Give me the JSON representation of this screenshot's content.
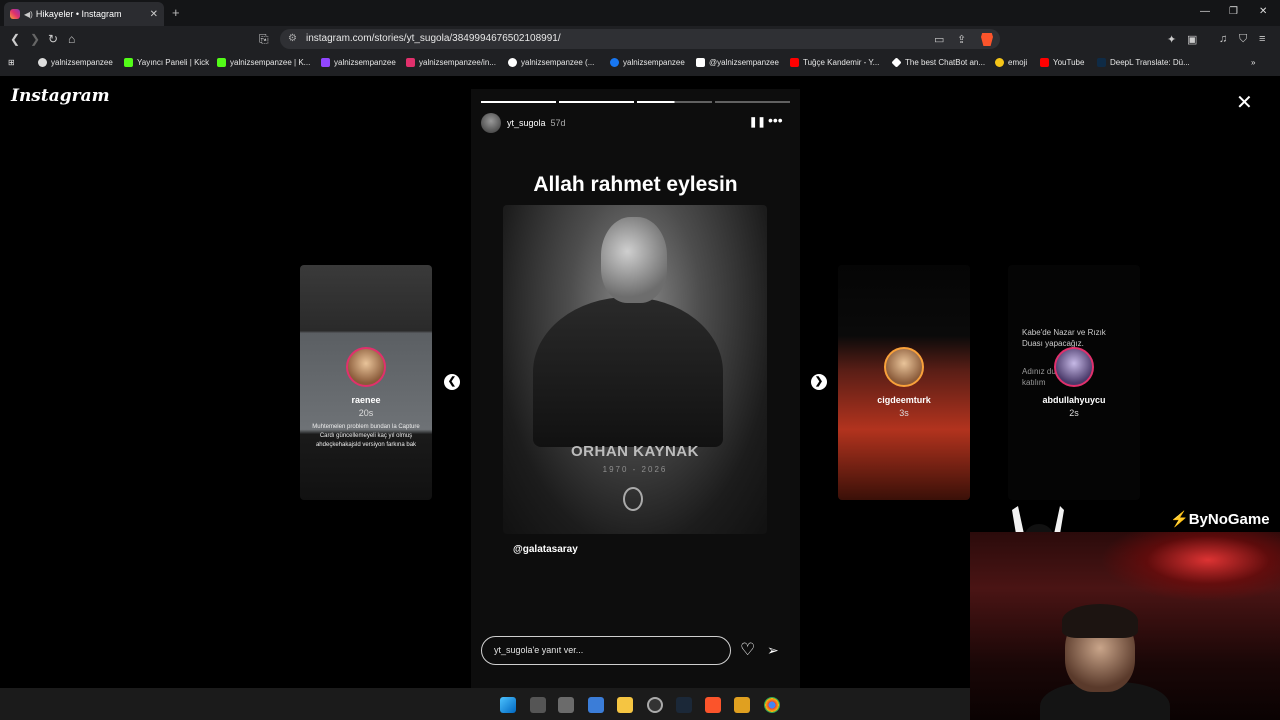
{
  "browser": {
    "tab_title": "Hikayeler • Instagram",
    "url": "instagram.com/stories/yt_sugola/3849994676502108991/",
    "bookmarks": [
      {
        "label": "yalnizsempanzee",
        "color": "#dddddd"
      },
      {
        "label": "Yayıncı Paneli | Kick",
        "color": "#53fc18"
      },
      {
        "label": "yalnizsempanzee | K...",
        "color": "#53fc18"
      },
      {
        "label": "yalnizsempanzee",
        "color": "#9146ff"
      },
      {
        "label": "yalnizsempanzee/in...",
        "color": "#e1306c"
      },
      {
        "label": "yalnizsempanzee (...",
        "color": "#ffffff"
      },
      {
        "label": "yalnizsempanzee",
        "color": "#1877f2"
      },
      {
        "label": "@yalnizsempanzee",
        "color": "#ffffff"
      },
      {
        "label": "Tuğçe Kandemir - Y...",
        "color": "#ff0000"
      },
      {
        "label": "The best ChatBot an...",
        "color": "#ffffff"
      },
      {
        "label": "emoji",
        "color": "#f5c518"
      },
      {
        "label": "YouTube",
        "color": "#ff0000"
      },
      {
        "label": "DeepL Translate: Dü...",
        "color": "#0f2b46"
      }
    ]
  },
  "instagram": {
    "logo": "Instagram"
  },
  "story": {
    "username": "yt_sugola",
    "time": "57d",
    "caption": "Allah rahmet eylesin",
    "photo_name": "ORHAN KAYNAK",
    "photo_years": "1970 - 2026",
    "mention": "@galatasaray",
    "reply_placeholder": "yt_sugola'e yanıt ver..."
  },
  "side_stories": {
    "left": {
      "user": "raenee",
      "time": "20s",
      "text": "Muhtemelen problem bundan la Capture Cardı güncellemeyeli kaç yıl olmuş ahdeçkehakajsld versiyon farkına bak"
    },
    "right1": {
      "user": "cigdeemturk",
      "time": "3s"
    },
    "right2": {
      "user": "abdullahyuycu",
      "time": "2s",
      "text1": "Kabe'de Nazar ve Rızık Duası yapacağız.",
      "text2": "Adınız duamıza katılım"
    }
  },
  "overlay": {
    "brand": "ByNoGame"
  }
}
